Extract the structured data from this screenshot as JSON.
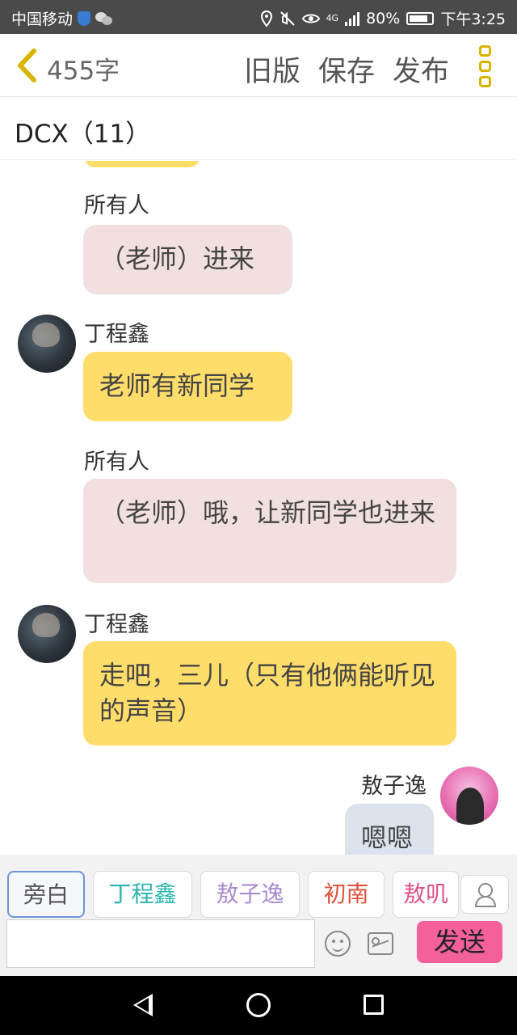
{
  "statusbar": {
    "carrier": "中国移动",
    "network": "4G",
    "battery": "80%",
    "time": "下午3:25"
  },
  "header": {
    "word_count": "455字",
    "old_version": "旧版",
    "save": "保存",
    "publish": "发布"
  },
  "conversation": {
    "title": "DCX（11）"
  },
  "messages": [
    {
      "speaker": "所有人",
      "text": "（老师）进来",
      "style": "pink"
    },
    {
      "speaker": "丁程鑫",
      "text": "老师有新同学",
      "style": "yellow"
    },
    {
      "speaker": "所有人",
      "text": "（老师）哦，让新同学也进来",
      "style": "pink"
    },
    {
      "speaker": "丁程鑫",
      "text": "走吧，三儿（只有他俩能听见的声音）",
      "style": "yellow"
    },
    {
      "speaker": "敖子逸",
      "text": "嗯嗯",
      "style": "grey"
    }
  ],
  "roles": [
    {
      "label": "旁白",
      "color": "#555555"
    },
    {
      "label": "丁程鑫",
      "color": "#2bb5b0"
    },
    {
      "label": "敖子逸",
      "color": "#a98bd0"
    },
    {
      "label": "初南",
      "color": "#e0523a"
    },
    {
      "label": "敖叽",
      "color": "#e0528a"
    }
  ],
  "input": {
    "placeholder": "",
    "value": "",
    "send": "发送"
  }
}
